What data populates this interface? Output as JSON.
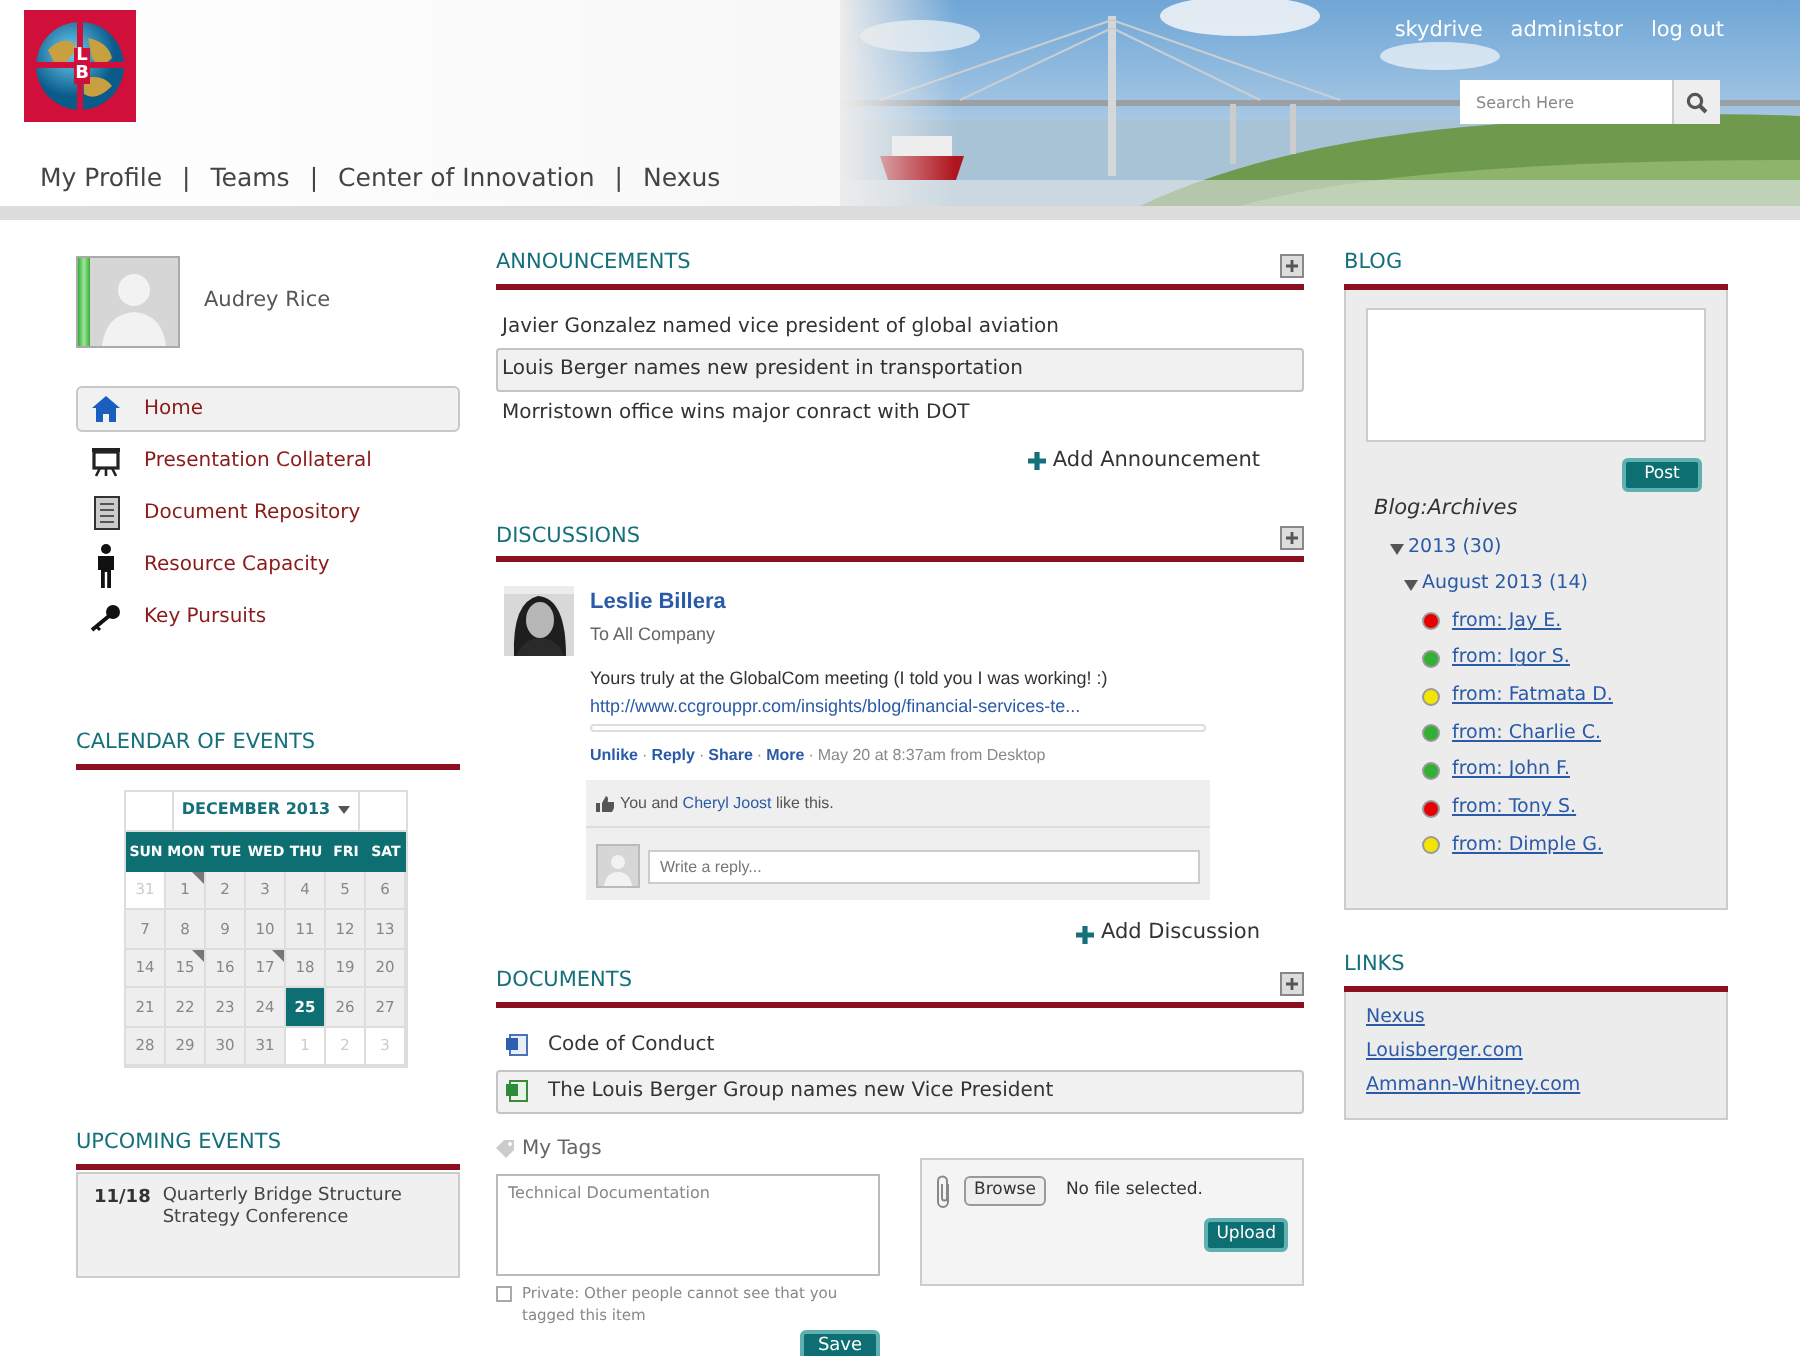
{
  "header": {
    "logo_letters": [
      "L",
      "B"
    ],
    "nav": [
      "My Profile",
      "Teams",
      "Center of Innovation",
      "Nexus"
    ],
    "nav_separator": "|",
    "top_links": [
      "skydrive",
      "administor",
      "log out"
    ],
    "search": {
      "placeholder": "Search Here"
    }
  },
  "profile": {
    "name": "Audrey Rice"
  },
  "sidebar": {
    "items": [
      {
        "label": "Home",
        "kind": "home",
        "selected": true
      },
      {
        "label": "Presentation Collateral",
        "kind": "presentation",
        "selected": false
      },
      {
        "label": "Document Repository",
        "kind": "document",
        "selected": false
      },
      {
        "label": "Resource Capacity",
        "kind": "person",
        "selected": false
      },
      {
        "label": "Key Pursuits",
        "kind": "key",
        "selected": false
      }
    ]
  },
  "calendar": {
    "title": "CALENDAR OF EVENTS",
    "month": "DECEMBER 2013",
    "weekdays": [
      "SUN",
      "MON",
      "TUE",
      "WED",
      "THU",
      "FRI",
      "SAT"
    ],
    "weeks": [
      [
        {
          "day": "31",
          "other": true,
          "event": false,
          "selected": false
        },
        {
          "day": "1",
          "other": false,
          "event": true,
          "selected": false
        },
        {
          "day": "2",
          "other": false,
          "event": false,
          "selected": false
        },
        {
          "day": "3",
          "other": false,
          "event": false,
          "selected": false
        },
        {
          "day": "4",
          "other": false,
          "event": false,
          "selected": false
        },
        {
          "day": "5",
          "other": false,
          "event": false,
          "selected": false
        },
        {
          "day": "6",
          "other": false,
          "event": false,
          "selected": false
        }
      ],
      [
        {
          "day": "7",
          "other": false,
          "event": false,
          "selected": false
        },
        {
          "day": "8",
          "other": false,
          "event": false,
          "selected": false
        },
        {
          "day": "9",
          "other": false,
          "event": false,
          "selected": false
        },
        {
          "day": "10",
          "other": false,
          "event": false,
          "selected": false
        },
        {
          "day": "11",
          "other": false,
          "event": false,
          "selected": false
        },
        {
          "day": "12",
          "other": false,
          "event": false,
          "selected": false
        },
        {
          "day": "13",
          "other": false,
          "event": false,
          "selected": false
        }
      ],
      [
        {
          "day": "14",
          "other": false,
          "event": false,
          "selected": false
        },
        {
          "day": "15",
          "other": false,
          "event": true,
          "selected": false
        },
        {
          "day": "16",
          "other": false,
          "event": false,
          "selected": false
        },
        {
          "day": "17",
          "other": false,
          "event": true,
          "selected": false
        },
        {
          "day": "18",
          "other": false,
          "event": false,
          "selected": false
        },
        {
          "day": "19",
          "other": false,
          "event": false,
          "selected": false
        },
        {
          "day": "20",
          "other": false,
          "event": false,
          "selected": false
        }
      ],
      [
        {
          "day": "21",
          "other": false,
          "event": false,
          "selected": false
        },
        {
          "day": "22",
          "other": false,
          "event": false,
          "selected": false
        },
        {
          "day": "23",
          "other": false,
          "event": false,
          "selected": false
        },
        {
          "day": "24",
          "other": false,
          "event": false,
          "selected": false
        },
        {
          "day": "25",
          "other": false,
          "event": false,
          "selected": true
        },
        {
          "day": "26",
          "other": false,
          "event": false,
          "selected": false
        },
        {
          "day": "27",
          "other": false,
          "event": false,
          "selected": false
        }
      ],
      [
        {
          "day": "28",
          "other": false,
          "event": false,
          "selected": false
        },
        {
          "day": "29",
          "other": false,
          "event": false,
          "selected": false
        },
        {
          "day": "30",
          "other": false,
          "event": false,
          "selected": false
        },
        {
          "day": "31",
          "other": false,
          "event": false,
          "selected": false
        },
        {
          "day": "1",
          "other": true,
          "event": false,
          "selected": false
        },
        {
          "day": "2",
          "other": true,
          "event": false,
          "selected": false
        },
        {
          "day": "3",
          "other": true,
          "event": false,
          "selected": false
        }
      ]
    ]
  },
  "upcoming": {
    "title": "UPCOMING EVENTS",
    "events": [
      {
        "date": "11/18",
        "title": "Quarterly Bridge Structure Strategy Conference"
      }
    ]
  },
  "announcements": {
    "title": "ANNOUNCEMENTS",
    "items": [
      {
        "text": "Javier Gonzalez named vice president of global aviation",
        "selected": false
      },
      {
        "text": "Louis Berger names new president in transportation",
        "selected": true
      },
      {
        "text": "Morristown office wins major conract with DOT",
        "selected": false
      }
    ],
    "add": "Add Announcement"
  },
  "discussions": {
    "title": "DISCUSSIONS",
    "post": {
      "author": "Leslie Billera",
      "audience": "To All Company",
      "message": "Yours truly at the GlobalCom meeting (I told you I was working! :)",
      "link": "http://www.ccgrouppr.com/insights/blog/financial-services-te...",
      "actions": [
        "Unlike",
        "Reply",
        "Share",
        "More"
      ],
      "separator": "·",
      "meta": "May 20 at 8:37am from Desktop",
      "likes": {
        "before": "You and",
        "link": "Cheryl Joost",
        "after": "like this."
      },
      "reply_placeholder": "Write a reply..."
    },
    "add": "Add Discussion"
  },
  "documents": {
    "title": "DOCUMENTS",
    "items": [
      {
        "name": "Code of Conduct",
        "kind": "word",
        "selected": false
      },
      {
        "name": "The Louis Berger Group names new Vice President",
        "kind": "sheet",
        "selected": true
      }
    ]
  },
  "tags": {
    "label": "My Tags",
    "placeholder": "Technical Documentation",
    "private": {
      "label": "Private: Other people cannot see that you tagged this item",
      "checked": false
    },
    "save": "Save"
  },
  "upload": {
    "browse": "Browse",
    "status": "No file selected.",
    "button": "Upload"
  },
  "blog": {
    "title": "BLOG",
    "post": "Post",
    "archives_title": "Blog:Archives",
    "archives": [
      {
        "label": "2013 (30)",
        "expanded": true,
        "children": [
          {
            "label": "August 2013 (14)",
            "expanded": true,
            "children": [
              {
                "label": "from: Jay E.",
                "color": "#e60000"
              },
              {
                "label": "from: Igor S.",
                "color": "#33b033"
              },
              {
                "label": "from: Fatmata D.",
                "color": "#f2e600"
              },
              {
                "label": "from: Charlie C.",
                "color": "#33b033"
              },
              {
                "label": "from: John F.",
                "color": "#33b033"
              },
              {
                "label": "from: Tony S.",
                "color": "#e60000"
              },
              {
                "label": "from: Dimple G.",
                "color": "#f2e600"
              }
            ]
          }
        ]
      }
    ]
  },
  "links": {
    "title": "LINKS",
    "items": [
      "Nexus",
      "Louisberger.com",
      "Ammann-Whitney.com"
    ]
  }
}
